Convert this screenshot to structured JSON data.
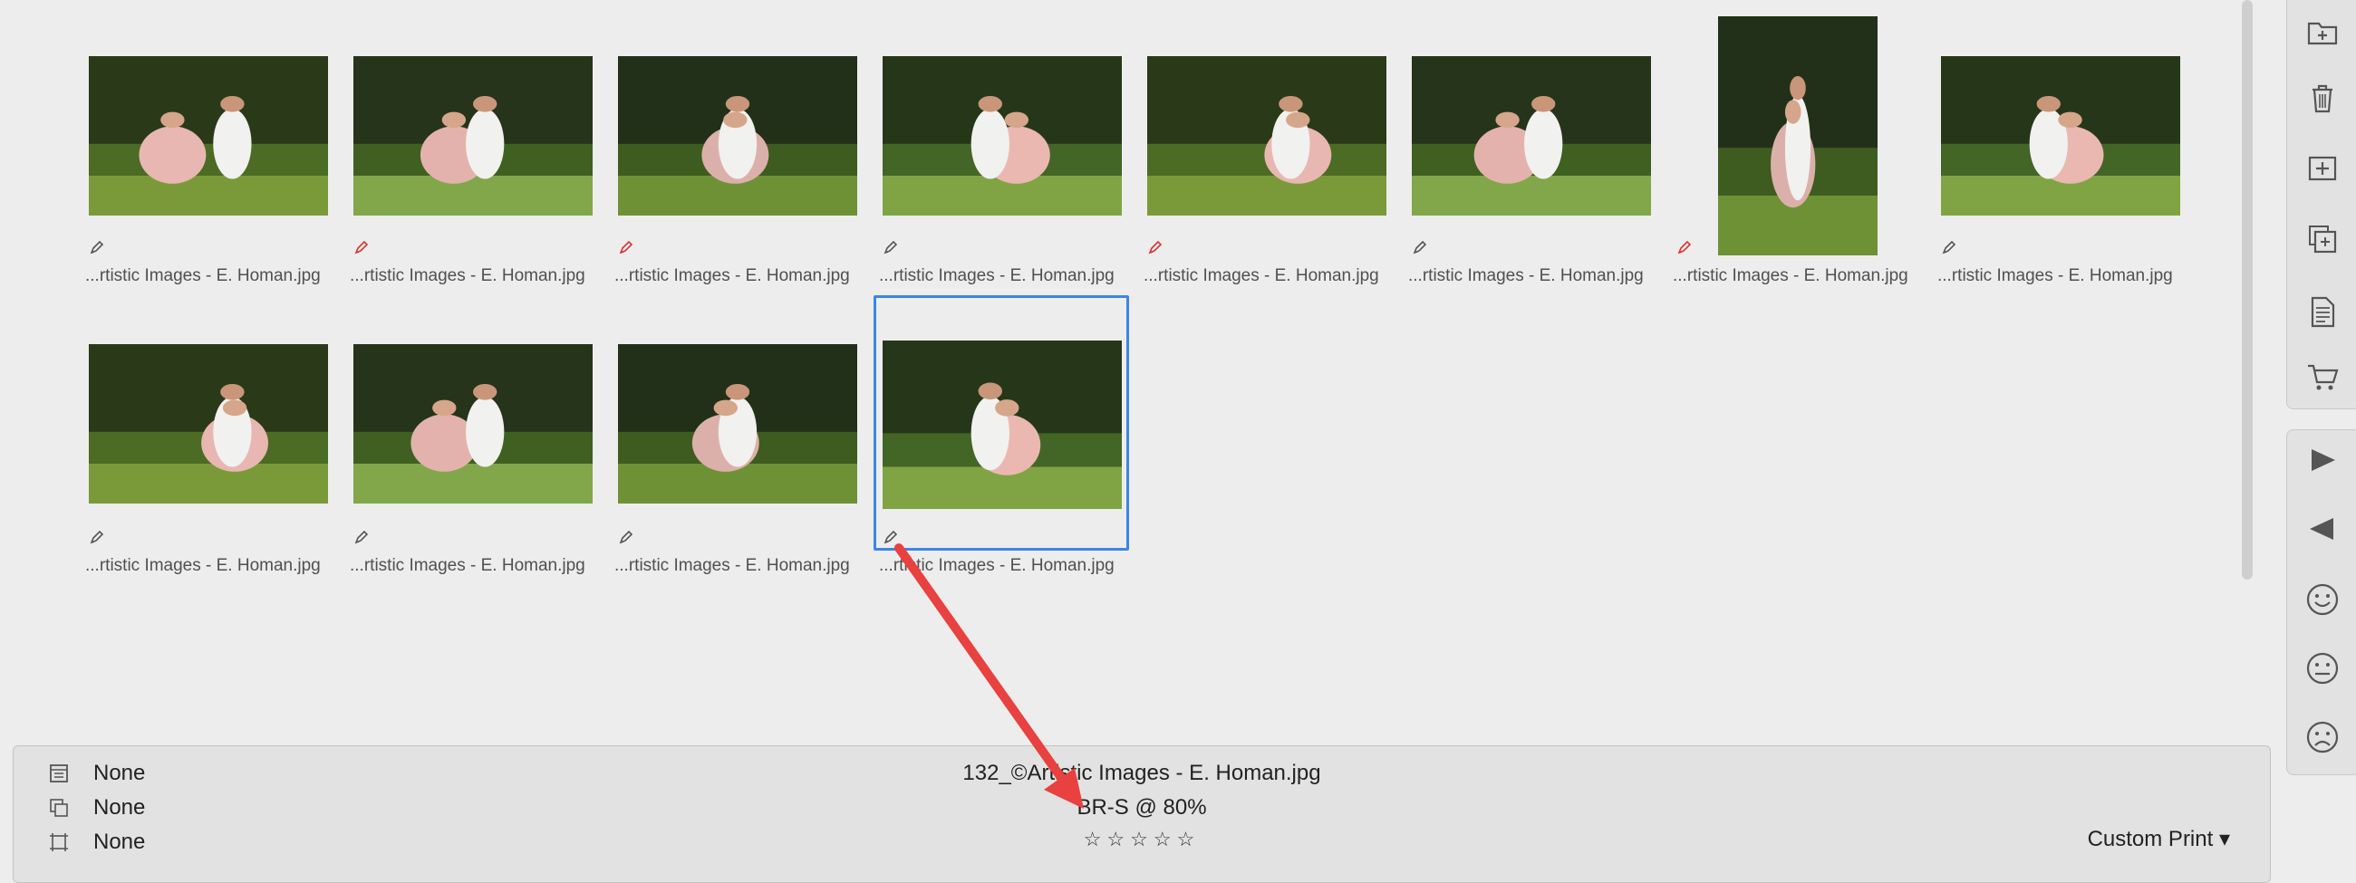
{
  "thumbnails": [
    {
      "caption": "...rtistic Images - E. Homan.jpg",
      "edit_color": "#555555"
    },
    {
      "caption": "...rtistic Images - E. Homan.jpg",
      "edit_color": "#d9322f"
    },
    {
      "caption": "...rtistic Images - E. Homan.jpg",
      "edit_color": "#d9322f"
    },
    {
      "caption": "...rtistic Images - E. Homan.jpg",
      "edit_color": "#555555"
    },
    {
      "caption": "...rtistic Images - E. Homan.jpg",
      "edit_color": "#d9322f"
    },
    {
      "caption": "...rtistic Images - E. Homan.jpg",
      "edit_color": "#555555"
    },
    {
      "caption": "...rtistic Images - E. Homan.jpg",
      "edit_color": "#d9322f"
    },
    {
      "caption": "...rtistic Images - E. Homan.jpg",
      "edit_color": "#555555"
    },
    {
      "caption": "...rtistic Images - E. Homan.jpg",
      "edit_color": "#555555"
    },
    {
      "caption": "...rtistic Images - E. Homan.jpg",
      "edit_color": "#555555"
    },
    {
      "caption": "...rtistic Images - E. Homan.jpg",
      "edit_color": "#555555"
    },
    {
      "caption": "...rtistic Images - E. Homan.jpg",
      "edit_color": "#555555",
      "selected": true
    }
  ],
  "info_bar": {
    "row1_label": "None",
    "row2_label": "None",
    "row3_label": "None",
    "filename": "132_©Artistic Images - E. Homan.jpg",
    "crop": "BR-S @ 80%",
    "rating_stars": "☆☆☆☆☆",
    "rating_value": 0,
    "print_menu": "Custom Print ▾"
  },
  "toolbar": {
    "icons": [
      "add-folder-icon",
      "trash-icon",
      "add-image-icon",
      "duplicate-icon",
      "document-icon",
      "cart-icon",
      "play-forward-icon",
      "play-back-icon",
      "happy-face-icon",
      "neutral-face-icon",
      "sad-face-icon"
    ]
  },
  "colors": {
    "selection": "#3b86e6",
    "arrow": "#e8413f",
    "edited_marker": "#d9322f"
  }
}
